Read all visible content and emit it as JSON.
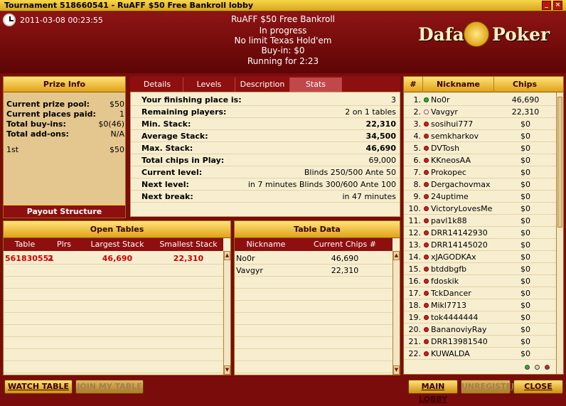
{
  "window": {
    "title": "Tournament 518660541 - RuAFF $50 Free Bankroll lobby"
  },
  "header": {
    "datetime": "2011-03-08 00:23:55",
    "name": "RuAFF $50 Free Bankroll",
    "status": "In progress",
    "game": "No limit Texas Hold'em",
    "buyin": "Buy-in: $0",
    "running": "Running for 2:23",
    "logo_left": "Dafa",
    "logo_right": "Poker"
  },
  "prize_info": {
    "title": "Prize Info",
    "rows": [
      {
        "label": "Current prize pool:",
        "value": "$50"
      },
      {
        "label": "Current places paid:",
        "value": "1"
      },
      {
        "label": "Total buy-ins:",
        "value": "$0(46)"
      },
      {
        "label": "Total add-ons:",
        "value": "N/A"
      }
    ],
    "places": [
      {
        "label": "1st",
        "value": "$50"
      }
    ],
    "payout_button": "Payout Structure"
  },
  "tabs": [
    "Details",
    "Levels",
    "Description",
    "Stats"
  ],
  "active_tab": "Stats",
  "stats": [
    {
      "label": "Your finishing place is:",
      "value": "3",
      "bold": false
    },
    {
      "label": "Remaining players:",
      "value": "2 on 1 tables",
      "bold": false
    },
    {
      "label": "Min. Stack:",
      "value": "22,310",
      "bold": true
    },
    {
      "label": "Average Stack:",
      "value": "34,500",
      "bold": true
    },
    {
      "label": "Max. Stack:",
      "value": "46,690",
      "bold": true
    },
    {
      "label": "Total chips in Play:",
      "value": "69,000",
      "bold": false
    },
    {
      "label": "Current level:",
      "value": "Blinds 250/500 Ante 50",
      "bold": false
    },
    {
      "label": "Next level:",
      "value": "in 7 minutes Blinds 300/600 Ante 100",
      "bold": false
    },
    {
      "label": "Next break:",
      "value": "in 47 minutes",
      "bold": false
    }
  ],
  "players": {
    "headers": {
      "num": "#",
      "nick": "Nickname",
      "chips": "Chips"
    },
    "rows": [
      {
        "n": "1.",
        "nick": "No0r",
        "chips": "46,690",
        "status": "green"
      },
      {
        "n": "2.",
        "nick": "Vavgyr",
        "chips": "22,310",
        "status": "white"
      },
      {
        "n": "3.",
        "nick": "sosihui777",
        "chips": "$0",
        "status": "red"
      },
      {
        "n": "4.",
        "nick": "semkharkov",
        "chips": "$0",
        "status": "red"
      },
      {
        "n": "5.",
        "nick": "DVTosh",
        "chips": "$0",
        "status": "red"
      },
      {
        "n": "6.",
        "nick": "KKneosAA",
        "chips": "$0",
        "status": "red"
      },
      {
        "n": "7.",
        "nick": "Prokopec",
        "chips": "$0",
        "status": "red"
      },
      {
        "n": "8.",
        "nick": "Dergachovmax",
        "chips": "$0",
        "status": "red"
      },
      {
        "n": "9.",
        "nick": "24uptime",
        "chips": "$0",
        "status": "red"
      },
      {
        "n": "10.",
        "nick": "VictoryLovesMe",
        "chips": "$0",
        "status": "red"
      },
      {
        "n": "11.",
        "nick": "pavl1k88",
        "chips": "$0",
        "status": "red"
      },
      {
        "n": "12.",
        "nick": "DRR14142930",
        "chips": "$0",
        "status": "red"
      },
      {
        "n": "13.",
        "nick": "DRR14145020",
        "chips": "$0",
        "status": "red"
      },
      {
        "n": "14.",
        "nick": "xJAGODKAx",
        "chips": "$0",
        "status": "red"
      },
      {
        "n": "15.",
        "nick": "btddbgfb",
        "chips": "$0",
        "status": "red"
      },
      {
        "n": "16.",
        "nick": "fdoskik",
        "chips": "$0",
        "status": "red"
      },
      {
        "n": "17.",
        "nick": "TckDancer",
        "chips": "$0",
        "status": "red"
      },
      {
        "n": "18.",
        "nick": "Mikl7713",
        "chips": "$0",
        "status": "red"
      },
      {
        "n": "19.",
        "nick": "tok4444444",
        "chips": "$0",
        "status": "red"
      },
      {
        "n": "20.",
        "nick": "BananoviyRay",
        "chips": "$0",
        "status": "red"
      },
      {
        "n": "21.",
        "nick": "DRR13981540",
        "chips": "$0",
        "status": "red"
      },
      {
        "n": "22.",
        "nick": "KUWALDA",
        "chips": "$0",
        "status": "red"
      }
    ]
  },
  "open_tables": {
    "title": "Open Tables",
    "headers": [
      "Table",
      "Plrs",
      "Largest Stack",
      "Smallest Stack"
    ],
    "rows": [
      {
        "table": "561830551",
        "plrs": "2",
        "largest": "46,690",
        "smallest": "22,310"
      }
    ]
  },
  "table_data": {
    "title": "Table Data",
    "headers": [
      "Nickname",
      "Current Chips #"
    ],
    "rows": [
      {
        "nick": "No0r",
        "chips": "46,690"
      },
      {
        "nick": "Vavgyr",
        "chips": "22,310"
      }
    ]
  },
  "buttons": {
    "watch": "WATCH TABLE",
    "join": "JOIN MY TABLE",
    "main_lobby": "MAIN LOBBY",
    "unregister": "UNREGISTER",
    "close": "CLOSE"
  },
  "colors": {
    "accent": "#7a0c0c",
    "gold": "#e0a21a",
    "panel": "#f7eed0"
  }
}
